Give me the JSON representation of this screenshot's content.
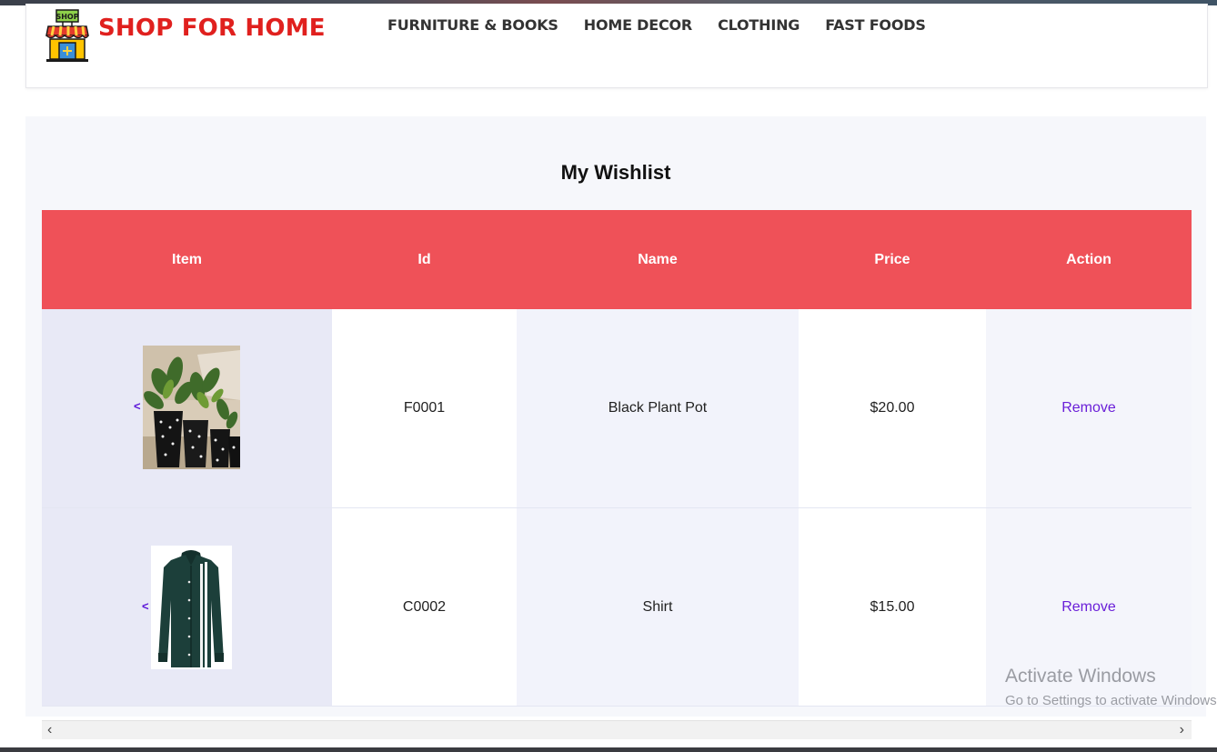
{
  "brand": {
    "name": "SHOP FOR HOME",
    "icon": "shop-store-icon",
    "icon_sign": "SHOP"
  },
  "nav": [
    "FURNITURE & BOOKS",
    "HOME DECOR",
    "CLOTHING",
    "FAST FOODS"
  ],
  "page_title": "My Wishlist",
  "table": {
    "headers": [
      "Item",
      "Id",
      "Name",
      "Price",
      "Action"
    ],
    "rows": [
      {
        "marker": "<",
        "image": "plant-pots-thumbnail",
        "id": "F0001",
        "name": "Black Plant Pot",
        "price": "$20.00",
        "action": "Remove"
      },
      {
        "marker": "<",
        "image": "shirt-thumbnail",
        "id": "C0002",
        "name": "Shirt",
        "price": "$15.00",
        "action": "Remove"
      }
    ]
  },
  "scrollbar": {
    "left": "‹",
    "right": "›"
  },
  "watermark": {
    "line1": "Activate Windows",
    "line2": "Go to Settings to activate Windows."
  },
  "colors": {
    "brand": "#e0201e",
    "header_bg": "#ef5158",
    "link": "#6a1fd8"
  }
}
